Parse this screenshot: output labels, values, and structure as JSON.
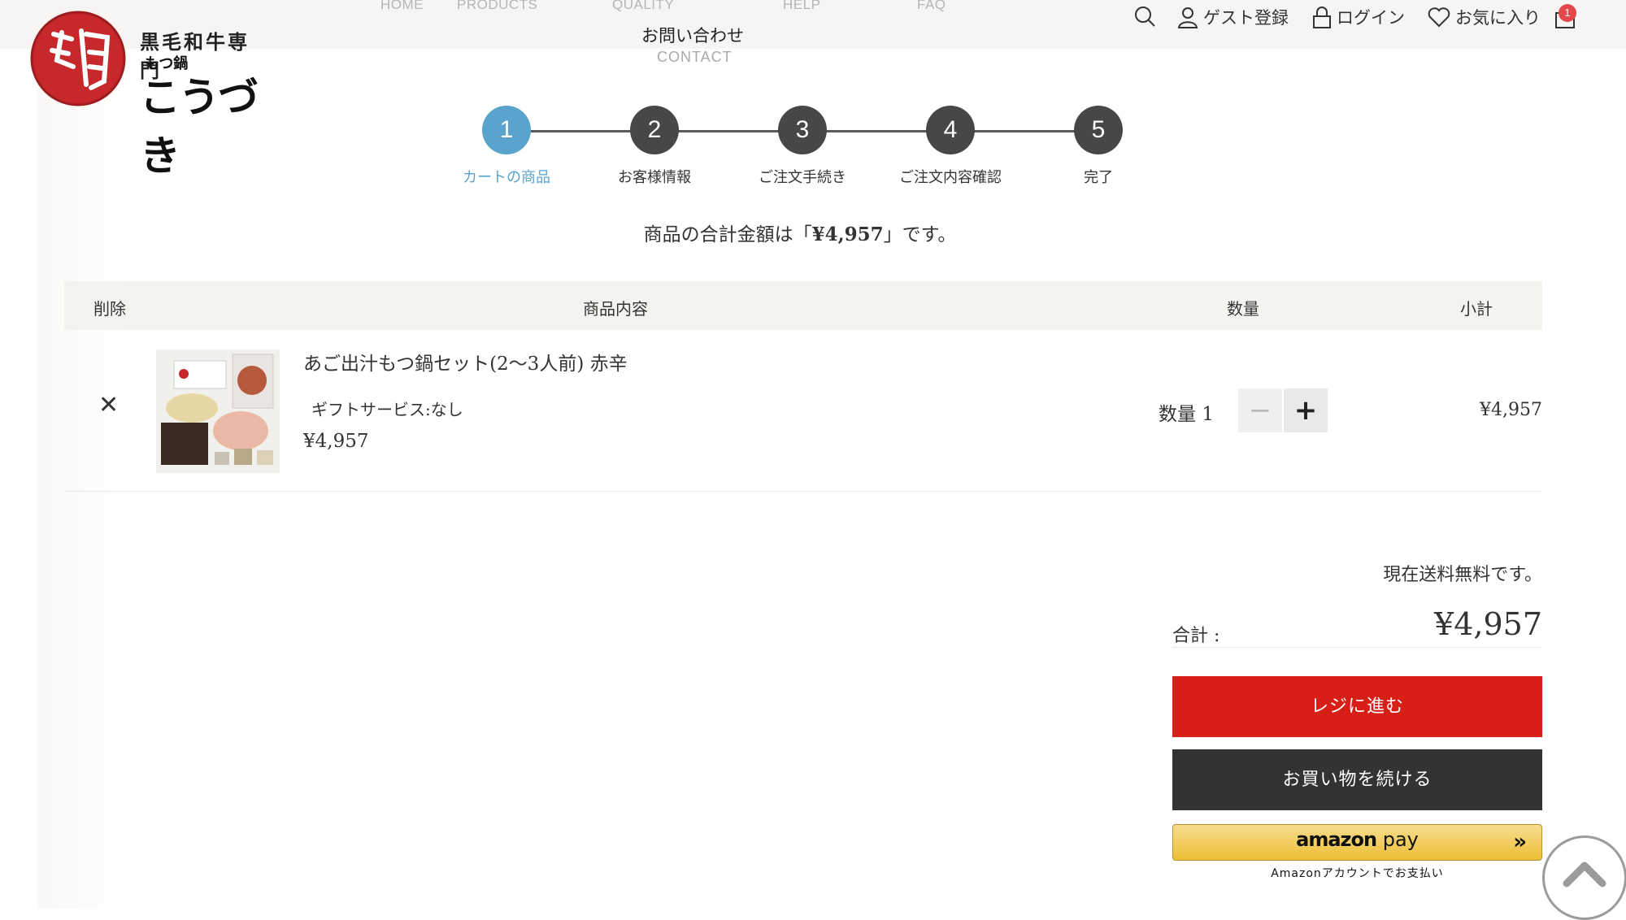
{
  "logo": {
    "subtitle": "黒毛和牛専門",
    "small": "もつ鍋",
    "main": "こうづき",
    "seal": "紅月"
  },
  "nav": {
    "items": [
      "HOME",
      "PRODUCTS",
      "QUALITY",
      "HELP",
      "FAQ"
    ],
    "contact_jp": "お問い合わせ",
    "contact_en": "CONTACT"
  },
  "header": {
    "guest": "ゲスト登録",
    "login": "ログイン",
    "favorites": "お気に入り",
    "cart_count": "1"
  },
  "steps": [
    {
      "num": "1",
      "label": "カートの商品",
      "active": true
    },
    {
      "num": "2",
      "label": "お客様情報"
    },
    {
      "num": "3",
      "label": "ご注文手続き"
    },
    {
      "num": "4",
      "label": "ご注文内容確認"
    },
    {
      "num": "5",
      "label": "完了"
    }
  ],
  "total_message": {
    "prefix": "商品の合計金額は「",
    "amount": "¥4,957",
    "suffix": "」です。"
  },
  "table": {
    "headers": {
      "delete": "削除",
      "content": "商品内容",
      "qty": "数量",
      "subtotal": "小計"
    },
    "rows": [
      {
        "name": "あご出汁もつ鍋セット(2〜3人前) 赤辛",
        "gift": "ギフトサービス:なし",
        "price": "¥4,957",
        "qty_label": "数量",
        "qty": "1",
        "subtotal": "¥4,957"
      }
    ]
  },
  "summary": {
    "shipping": "現在送料無料です。",
    "total_label": "合計 :",
    "total_value": "¥4,957",
    "checkout": "レジに進む",
    "continue": "お買い物を続ける",
    "amazon_brand": "amazon",
    "amazon_pay": " pay",
    "amazon_caption": "Amazonアカウントでお支払い"
  },
  "colors": {
    "accent_blue": "#5aa3cc",
    "checkout_red": "#d71f17",
    "dark": "#333333",
    "amazon_gold": "#f0c14b"
  }
}
